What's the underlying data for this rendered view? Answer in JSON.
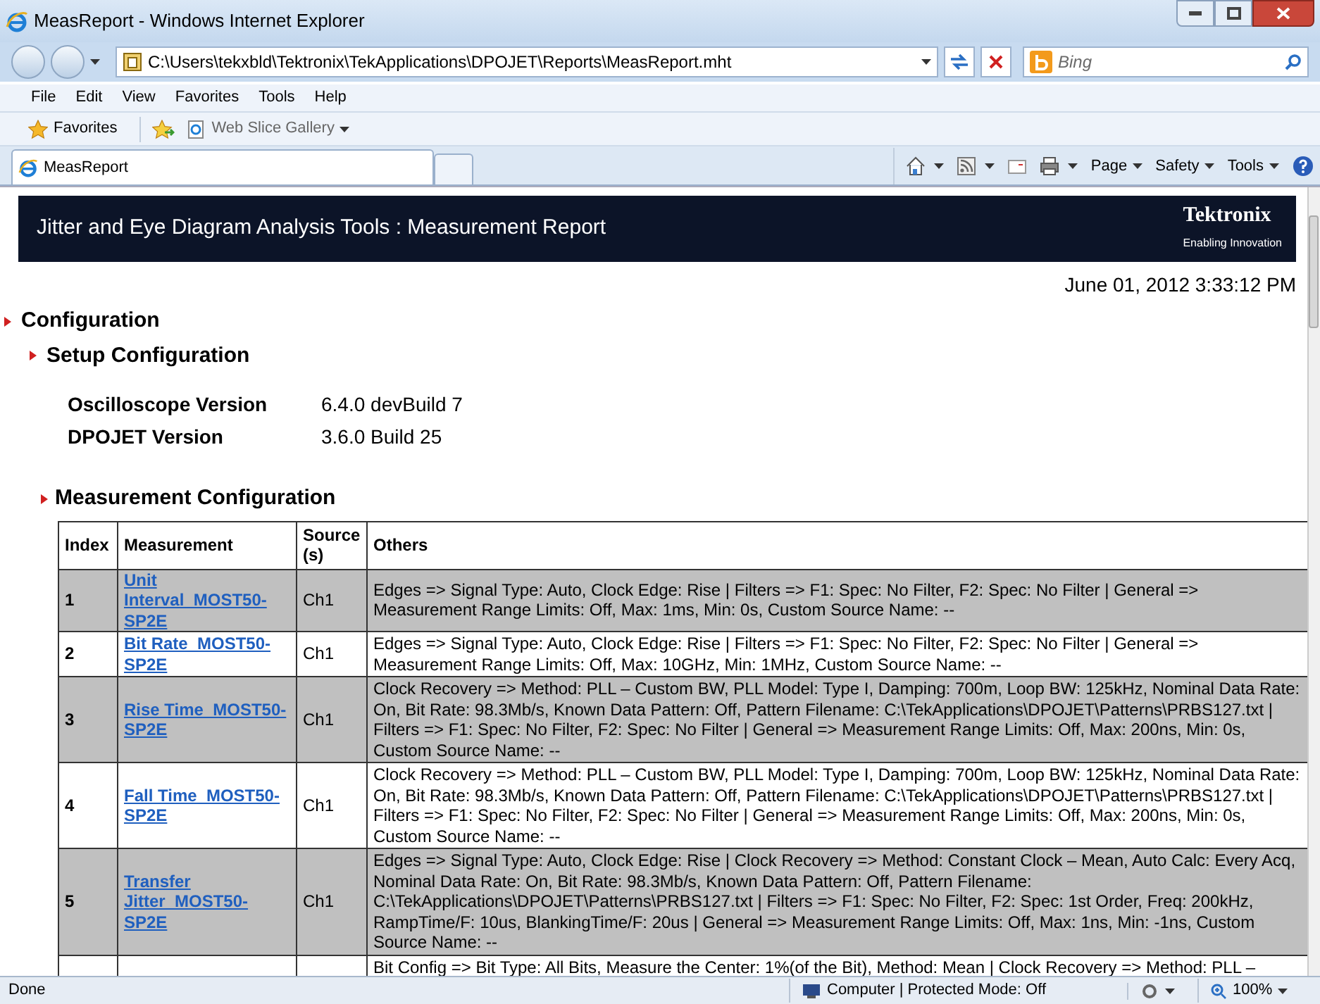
{
  "window": {
    "title": "MeasReport - Windows Internet Explorer"
  },
  "address_bar": {
    "url": "C:\\Users\\tekxbld\\Tektronix\\TekApplications\\DPOJET\\Reports\\MeasReport.mht",
    "search_placeholder": "Bing"
  },
  "menu": [
    "File",
    "Edit",
    "View",
    "Favorites",
    "Tools",
    "Help"
  ],
  "favorites_bar": {
    "favorites": "Favorites",
    "web_slice": "Web Slice Gallery"
  },
  "tab": {
    "title": "MeasReport"
  },
  "command_bar": [
    "Page",
    "Safety",
    "Tools"
  ],
  "report": {
    "title": "Jitter and Eye Diagram Analysis Tools : Measurement Report",
    "brand": "Tektronix",
    "tagline": "Enabling Innovation",
    "timestamp": "June 01, 2012 3:33:12 PM",
    "sections": [
      {
        "heading": "Configuration",
        "kind": "section"
      },
      {
        "heading": "Setup Configuration",
        "kind": "subsection"
      }
    ],
    "versions": [
      {
        "label": "Oscilloscope Version",
        "value": "6.4.0 devBuild 7"
      },
      {
        "label": "DPOJET Version",
        "value": "3.6.0 Build 25"
      }
    ],
    "table_heading": "Measurement Configuration",
    "table": {
      "columns": [
        "Index",
        "Measurement",
        "Source (s)",
        "Others"
      ],
      "rows": [
        {
          "index": "1",
          "measurement": "Unit Interval_MOST50-SP2E",
          "source": "Ch1",
          "others": "Edges => Signal Type: Auto, Clock Edge: Rise | Filters => F1: Spec: No Filter, F2: Spec: No Filter | General => Measurement Range Limits: Off, Max: 1ms, Min: 0s, Custom Source Name: --"
        },
        {
          "index": "2",
          "measurement": "Bit Rate_MOST50-SP2E",
          "source": "Ch1",
          "others": "Edges => Signal Type: Auto, Clock Edge: Rise | Filters => F1: Spec: No Filter, F2: Spec: No Filter | General => Measurement Range Limits: Off, Max: 10GHz, Min: 1MHz, Custom Source Name: --"
        },
        {
          "index": "3",
          "measurement": "Rise Time_MOST50-SP2E",
          "source": "Ch1",
          "others": "Clock Recovery => Method: PLL – Custom BW, PLL Model: Type I, Damping: 700m, Loop BW: 125kHz, Nominal Data Rate: On, Bit Rate: 98.3Mb/s, Known Data Pattern: Off, Pattern Filename: C:\\TekApplications\\DPOJET\\Patterns\\PRBS127.txt | Filters => F1: Spec: No Filter, F2: Spec: No Filter | General => Measurement Range Limits: Off, Max: 200ns, Min: 0s, Custom Source Name: --"
        },
        {
          "index": "4",
          "measurement": "Fall Time_MOST50-SP2E",
          "source": "Ch1",
          "others": "Clock Recovery => Method: PLL – Custom BW, PLL Model: Type I, Damping: 700m, Loop BW: 125kHz, Nominal Data Rate: On, Bit Rate: 98.3Mb/s, Known Data Pattern: Off, Pattern Filename: C:\\TekApplications\\DPOJET\\Patterns\\PRBS127.txt | Filters => F1: Spec: No Filter, F2: Spec: No Filter | General => Measurement Range Limits: Off, Max: 200ns, Min: 0s, Custom Source Name: --"
        },
        {
          "index": "5",
          "measurement": "Transfer Jitter_MOST50-SP2E",
          "source": "Ch1",
          "others": "Edges => Signal Type: Auto, Clock Edge: Rise | Clock Recovery => Method: Constant Clock – Mean, Auto Calc: Every Acq, Nominal Data Rate: On, Bit Rate: 98.3Mb/s, Known Data Pattern: Off, Pattern Filename: C:\\TekApplications\\DPOJET\\Patterns\\PRBS127.txt | Filters => F1: Spec: No Filter, F2: Spec: 1st Order, Freq: 200kHz, RampTime/F: 10us, BlankingTime/F: 20us | General => Measurement Range Limits: Off, Max: 1ns, Min: -1ns, Custom Source Name: --"
        },
        {
          "others": "Bit Config => Bit Type: All Bits, Measure the Center: 1%(of the Bit), Method: Mean | Clock Recovery => Method: PLL –"
        }
      ]
    }
  },
  "status_bar": {
    "left": "Done",
    "zone": "Computer | Protected Mode: Off",
    "zoom": "100%"
  }
}
